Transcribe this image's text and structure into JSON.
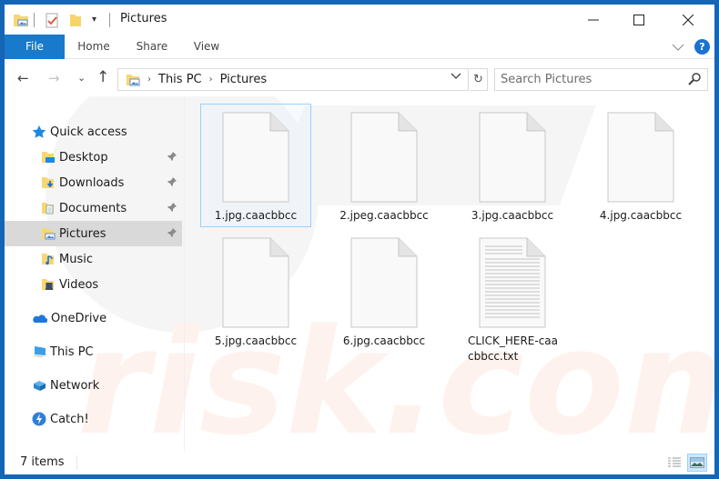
{
  "window": {
    "title": "Pictures",
    "controls": {
      "minimize": "—",
      "maximize": "☐",
      "close": "✕"
    }
  },
  "ribbon": {
    "tabs": [
      {
        "label": "File",
        "active": true
      },
      {
        "label": "Home"
      },
      {
        "label": "Share"
      },
      {
        "label": "View"
      }
    ],
    "help_label": "?"
  },
  "navigation": {
    "back": "←",
    "forward": "→",
    "recent": "⌄",
    "up": "↑",
    "breadcrumb": [
      "This PC",
      "Pictures"
    ],
    "breadcrumb_sep": "›",
    "refresh": "↻",
    "search_placeholder": "Search Pictures"
  },
  "sidebar": {
    "items": [
      {
        "label": "Quick access",
        "icon": "star-icon",
        "level": 0
      },
      {
        "label": "Desktop",
        "icon": "desktop-folder-icon",
        "level": 1,
        "pinned": true
      },
      {
        "label": "Downloads",
        "icon": "downloads-folder-icon",
        "level": 1,
        "pinned": true
      },
      {
        "label": "Documents",
        "icon": "documents-folder-icon",
        "level": 1,
        "pinned": true
      },
      {
        "label": "Pictures",
        "icon": "pictures-folder-icon",
        "level": 1,
        "pinned": true,
        "selected": true
      },
      {
        "label": "Music",
        "icon": "music-folder-icon",
        "level": 1
      },
      {
        "label": "Videos",
        "icon": "videos-folder-icon",
        "level": 1
      },
      {
        "label": "OneDrive",
        "icon": "onedrive-cloud-icon",
        "level": 0
      },
      {
        "label": "This PC",
        "icon": "computer-icon",
        "level": 0
      },
      {
        "label": "Network",
        "icon": "network-icon",
        "level": 0
      },
      {
        "label": "Catch!",
        "icon": "catch-app-icon",
        "level": 0
      }
    ]
  },
  "files": [
    {
      "name": "1.jpg.caacbbcc",
      "type": "blank",
      "selected": true
    },
    {
      "name": "2.jpeg.caacbbcc",
      "type": "blank"
    },
    {
      "name": "3.jpg.caacbbcc",
      "type": "blank"
    },
    {
      "name": "4.jpg.caacbbcc",
      "type": "blank"
    },
    {
      "name": "5.jpg.caacbbcc",
      "type": "blank"
    },
    {
      "name": "6.jpg.caacbbcc",
      "type": "blank"
    },
    {
      "name": "CLICK_HERE-caacbbcc.txt",
      "type": "text"
    }
  ],
  "statusbar": {
    "item_count": "7 items",
    "views": [
      "details-view",
      "large-icons-view"
    ],
    "active_view": "large-icons-view"
  },
  "colors": {
    "accent": "#1979ca",
    "window_border": "#1565b5",
    "selection": "#d9d9d9"
  }
}
